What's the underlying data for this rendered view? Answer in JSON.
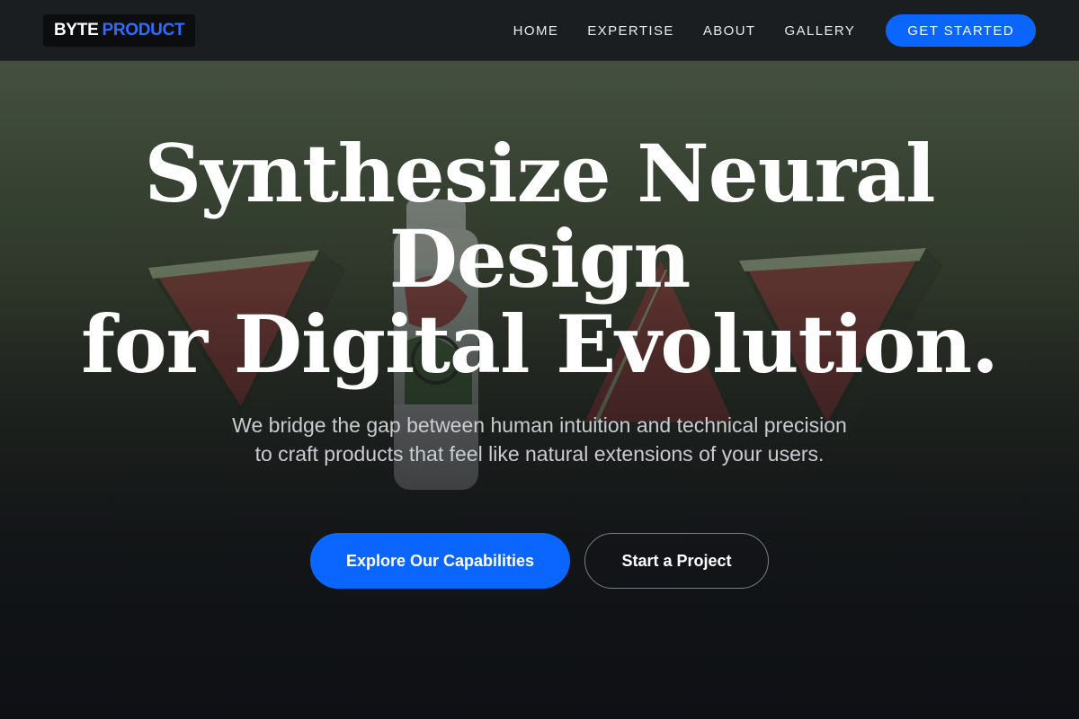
{
  "header": {
    "logo": {
      "primary": "BYTE",
      "accent": "PRODUCT"
    },
    "nav": [
      {
        "label": "HOME"
      },
      {
        "label": "EXPERTISE"
      },
      {
        "label": "ABOUT"
      },
      {
        "label": "GALLERY"
      }
    ],
    "cta_label": "GET STARTED"
  },
  "hero": {
    "title_lines": [
      "Synthesize Neural",
      "Design",
      "for Digital Evolution."
    ],
    "subtitle": "We bridge the gap between human intuition and technical precision to craft products that feel like natural extensions of your users.",
    "primary_button": "Explore Our Capabilities",
    "secondary_button": "Start a Project",
    "background_image": "watermelon-slices-and-bottle-photo"
  },
  "colors": {
    "accent": "#0a66ff",
    "header_bg": "#1b1e21",
    "logo_accent": "#2f6bff",
    "text": "#ffffff",
    "subtitle": "#c9ccd0"
  }
}
